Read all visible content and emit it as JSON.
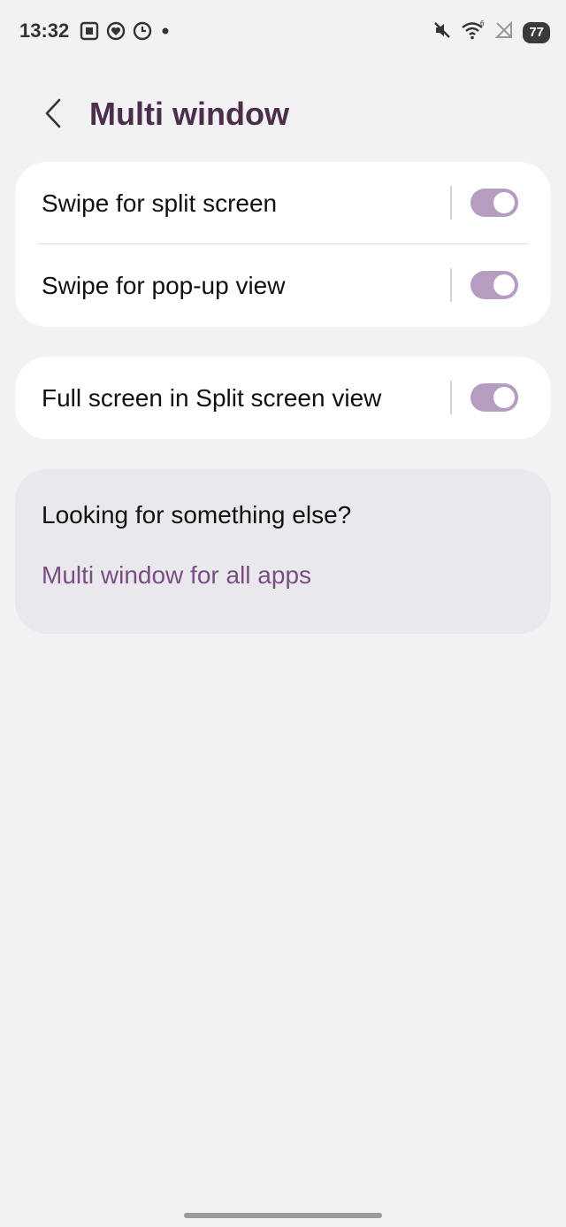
{
  "status_bar": {
    "time": "13:32",
    "battery": "77",
    "left_icons": [
      "screenshot-icon",
      "health-icon",
      "clock-icon",
      "dot-icon"
    ],
    "right_icons": [
      "mute-icon",
      "wifi-icon",
      "no-signal-icon"
    ]
  },
  "header": {
    "title": "Multi window",
    "back_icon": "chevron-left-icon"
  },
  "settings_group_1": [
    {
      "label": "Swipe for split screen",
      "enabled": true
    },
    {
      "label": "Swipe for pop-up view",
      "enabled": true
    }
  ],
  "settings_group_2": [
    {
      "label": "Full screen in Split screen view",
      "enabled": true
    }
  ],
  "suggestions": {
    "title": "Looking for something else?",
    "link": "Multi window for all apps"
  },
  "colors": {
    "accent": "#b69cc0",
    "title": "#4a2e4a",
    "link": "#7a4e84",
    "background": "#f2f2f4"
  }
}
